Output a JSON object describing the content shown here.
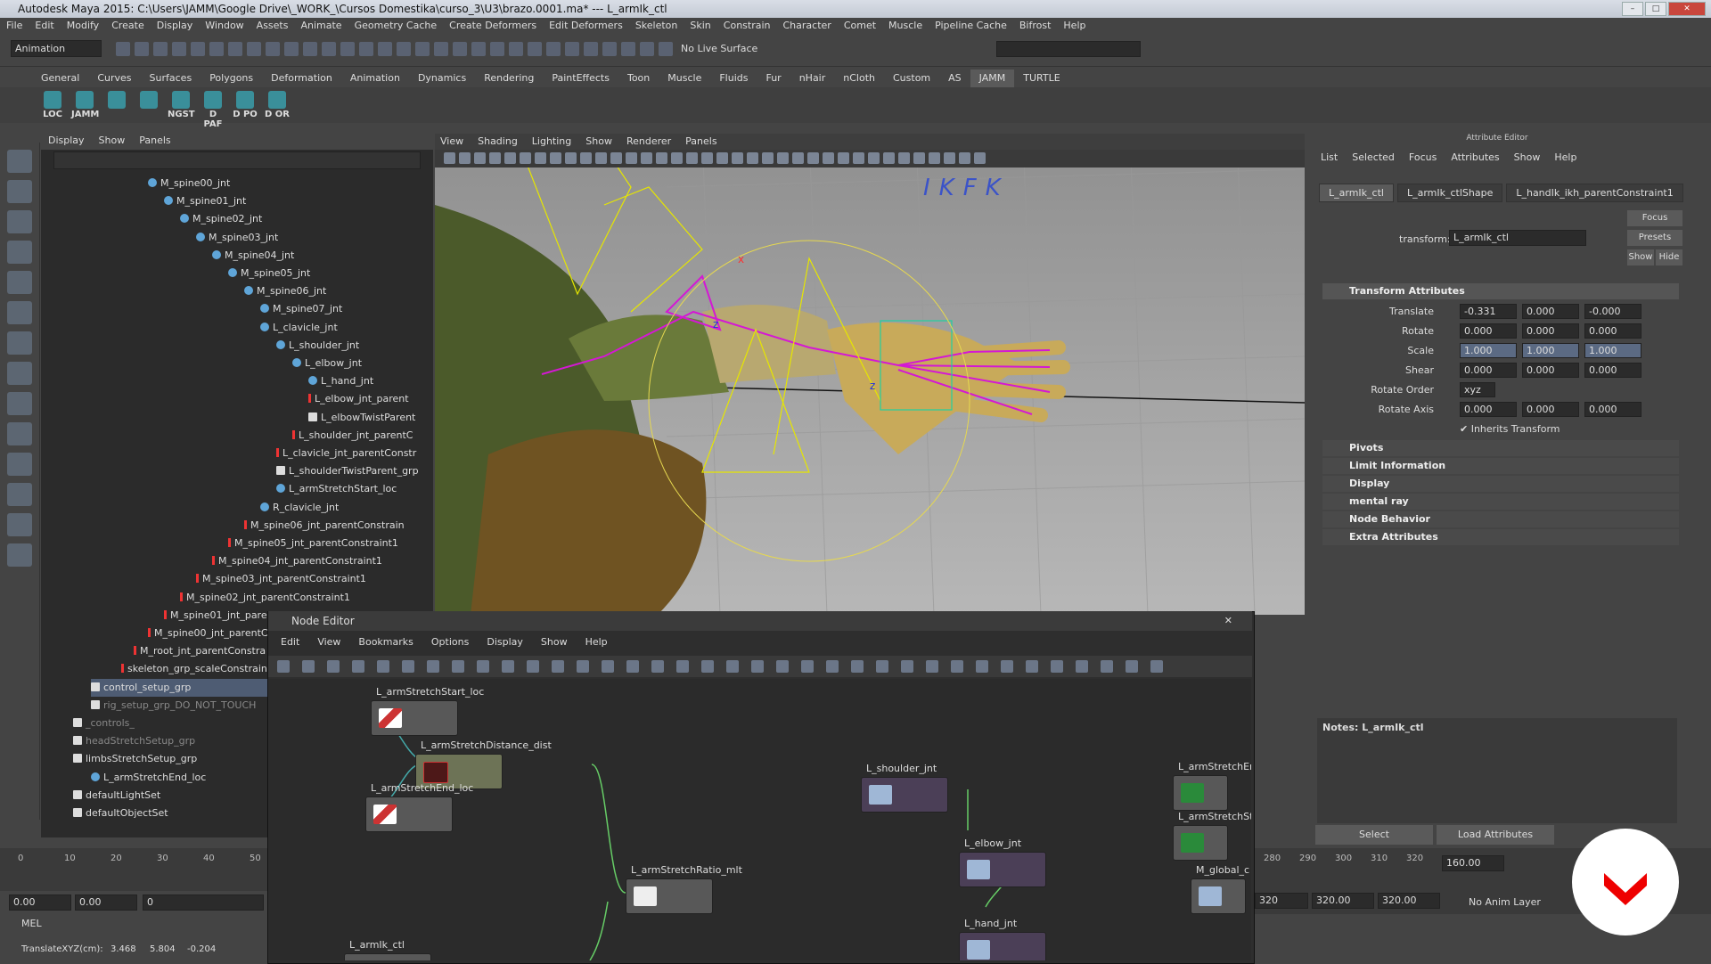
{
  "window": {
    "title": "Autodesk Maya 2015: C:\\Users\\JAMM\\Google Drive\\_WORK_\\Cursos Domestika\\curso_3\\U3\\brazo.0001.ma*   ---   L_armIk_ctl"
  },
  "menubar": [
    "File",
    "Edit",
    "Modify",
    "Create",
    "Display",
    "Window",
    "Assets",
    "Animate",
    "Geometry Cache",
    "Create Deformers",
    "Edit Deformers",
    "Skeleton",
    "Skin",
    "Constrain",
    "Character",
    "Comet",
    "Muscle",
    "Pipeline Cache",
    "Bifrost",
    "Help"
  ],
  "toolbar": {
    "mode": "Animation",
    "live_surface": "No Live Surface"
  },
  "shelf_tabs": [
    {
      "label": "General",
      "active": false
    },
    {
      "label": "Curves",
      "active": false
    },
    {
      "label": "Surfaces",
      "active": false
    },
    {
      "label": "Polygons",
      "active": false
    },
    {
      "label": "Deformation",
      "active": false
    },
    {
      "label": "Animation",
      "active": false
    },
    {
      "label": "Dynamics",
      "active": false
    },
    {
      "label": "Rendering",
      "active": false
    },
    {
      "label": "PaintEffects",
      "active": false
    },
    {
      "label": "Toon",
      "active": false
    },
    {
      "label": "Muscle",
      "active": false
    },
    {
      "label": "Fluids",
      "active": false
    },
    {
      "label": "Fur",
      "active": false
    },
    {
      "label": "nHair",
      "active": false
    },
    {
      "label": "nCloth",
      "active": false
    },
    {
      "label": "Custom",
      "active": false
    },
    {
      "label": "AS",
      "active": false
    },
    {
      "label": "JAMM",
      "active": true
    },
    {
      "label": "TURTLE",
      "active": false
    }
  ],
  "shelf_buttons": [
    "LOC",
    "JAMM",
    "",
    "",
    "NGST",
    "D PAF",
    "D PO",
    "D OR"
  ],
  "outliner": {
    "menu": [
      "Display",
      "Show",
      "Panels"
    ],
    "rows": [
      {
        "label": "M_spine00_jnt",
        "type": "joint",
        "state": "normal"
      },
      {
        "label": "M_spine01_jnt",
        "type": "joint",
        "state": "normal"
      },
      {
        "label": "M_spine02_jnt",
        "type": "joint",
        "state": "normal"
      },
      {
        "label": "M_spine03_jnt",
        "type": "joint",
        "state": "normal"
      },
      {
        "label": "M_spine04_jnt",
        "type": "joint",
        "state": "normal"
      },
      {
        "label": "M_spine05_jnt",
        "type": "joint",
        "state": "normal"
      },
      {
        "label": "M_spine06_jnt",
        "type": "joint",
        "state": "normal"
      },
      {
        "label": "M_spine07_jnt",
        "type": "joint",
        "state": "normal"
      },
      {
        "label": "L_clavicle_jnt",
        "type": "joint",
        "state": "normal"
      },
      {
        "label": "L_shoulder_jnt",
        "type": "joint",
        "state": "normal"
      },
      {
        "label": "L_elbow_jnt",
        "type": "joint",
        "state": "normal"
      },
      {
        "label": "L_hand_jnt",
        "type": "joint",
        "state": "normal"
      },
      {
        "label": "L_elbow_jnt_parent",
        "type": "constraint",
        "state": "normal"
      },
      {
        "label": "L_elbowTwistParent",
        "type": "group",
        "state": "normal"
      },
      {
        "label": "L_shoulder_jnt_parentC",
        "type": "constraint",
        "state": "normal"
      },
      {
        "label": "L_clavicle_jnt_parentConstr",
        "type": "constraint",
        "state": "normal"
      },
      {
        "label": "L_shoulderTwistParent_grp",
        "type": "group",
        "state": "normal"
      },
      {
        "label": "L_armStretchStart_loc",
        "type": "locator",
        "state": "normal"
      },
      {
        "label": "R_clavicle_jnt",
        "type": "joint",
        "state": "normal"
      },
      {
        "label": "M_spine06_jnt_parentConstrain",
        "type": "constraint",
        "state": "normal"
      },
      {
        "label": "M_spine05_jnt_parentConstraint1",
        "type": "constraint",
        "state": "normal"
      },
      {
        "label": "M_spine04_jnt_parentConstraint1",
        "type": "constraint",
        "state": "normal"
      },
      {
        "label": "M_spine03_jnt_parentConstraint1",
        "type": "constraint",
        "state": "normal"
      },
      {
        "label": "M_spine02_jnt_parentConstraint1",
        "type": "constraint",
        "state": "normal"
      },
      {
        "label": "M_spine01_jnt_parentConstraint1",
        "type": "constraint",
        "state": "normal"
      },
      {
        "label": "M_spine00_jnt_parentConstraint1",
        "type": "constraint",
        "state": "normal"
      },
      {
        "label": "M_root_jnt_parentConstra",
        "type": "constraint",
        "state": "normal"
      },
      {
        "label": "skeleton_grp_scaleConstraint1",
        "type": "constraint",
        "state": "normal"
      },
      {
        "label": "control_setup_grp",
        "type": "group",
        "state": "selected"
      },
      {
        "label": "rig_setup_grp_DO_NOT_TOUCH",
        "type": "group",
        "state": "dim"
      },
      {
        "label": "_controls_",
        "type": "group",
        "state": "dim"
      },
      {
        "label": "headStretchSetup_grp",
        "type": "group",
        "state": "dim"
      },
      {
        "label": "limbsStretchSetup_grp",
        "type": "group",
        "state": "normal"
      },
      {
        "label": "L_armStretchEnd_loc",
        "type": "locator",
        "state": "normal"
      },
      {
        "label": "defaultLightSet",
        "type": "set",
        "state": "normal"
      },
      {
        "label": "defaultObjectSet",
        "type": "set",
        "state": "normal"
      }
    ]
  },
  "viewport": {
    "menu": [
      "View",
      "Shading",
      "Lighting",
      "Show",
      "Renderer",
      "Panels"
    ],
    "overlay_text": "IKFK",
    "axis_labels": [
      "x",
      "z",
      "z"
    ]
  },
  "attribute_editor": {
    "title": "Attribute Editor",
    "menu": [
      "List",
      "Selected",
      "Focus",
      "Attributes",
      "Show",
      "Help"
    ],
    "tabs": [
      {
        "label": "L_armIk_ctl",
        "active": true
      },
      {
        "label": "L_armIk_ctlShape",
        "active": false
      },
      {
        "label": "L_handIk_ikh_parentConstraint1",
        "active": false
      }
    ],
    "transform_label": "transform:",
    "transform_value": "L_armIk_ctl",
    "buttons": {
      "focus": "Focus",
      "presets": "Presets",
      "show": "Show",
      "hide": "Hide"
    },
    "transform_section": "Transform Attributes",
    "attributes": [
      {
        "label": "Translate",
        "values": [
          "-0.331",
          "0.000",
          "-0.000"
        ],
        "highlight": false
      },
      {
        "label": "Rotate",
        "values": [
          "0.000",
          "0.000",
          "0.000"
        ],
        "highlight": false
      },
      {
        "label": "Scale",
        "values": [
          "1.000",
          "1.000",
          "1.000"
        ],
        "highlight": true
      },
      {
        "label": "Shear",
        "values": [
          "0.000",
          "0.000",
          "0.000"
        ],
        "highlight": false
      }
    ],
    "rotate_order_label": "Rotate Order",
    "rotate_order_value": "xyz",
    "rotate_axis_label": "Rotate Axis",
    "rotate_axis_values": [
      "0.000",
      "0.000",
      "0.000"
    ],
    "inherits_transform": "Inherits Transform",
    "collapsed_sections": [
      "Pivots",
      "Limit Information",
      "Display",
      "mental ray",
      "Node Behavior",
      "Extra Attributes"
    ],
    "notes_label": "Notes: L_armIk_ctl",
    "bottom_buttons": [
      "Select",
      "Load Attributes"
    ]
  },
  "node_editor": {
    "title": "Node Editor",
    "menu": [
      "Edit",
      "View",
      "Bookmarks",
      "Options",
      "Display",
      "Show",
      "Help"
    ],
    "nodes": [
      {
        "label": "L_armStretchStart_loc",
        "style": "locator"
      },
      {
        "label": "L_armStretchDistance_dist",
        "style": "distance"
      },
      {
        "label": "L_armStretchEnd_loc",
        "style": "locator"
      },
      {
        "label": "L_armStretchRatio_mlt",
        "style": "multiply"
      },
      {
        "label": "L_shoulder_jnt",
        "style": "joint"
      },
      {
        "label": "L_elbow_jnt",
        "style": "joint"
      },
      {
        "label": "L_hand_jnt",
        "style": "joint"
      },
      {
        "label": "L_armIk_ctl",
        "style": "locator"
      },
      {
        "label": "L_armStretchEr",
        "style": "multiply2"
      },
      {
        "label": "L_armStretchSt",
        "style": "multiply2"
      },
      {
        "label": "M_global_c",
        "style": "curve"
      }
    ]
  },
  "timeline": {
    "ticks": [
      "0",
      "10",
      "20",
      "30",
      "40",
      "50"
    ],
    "right_ticks": [
      "280",
      "290",
      "300",
      "310",
      "320"
    ],
    "current_frame": "160.00"
  },
  "range": {
    "start": "0.00",
    "inner_start": "0.00",
    "slider_value": "0",
    "end_value": "320",
    "end_a": "320.00",
    "end_b": "320.00",
    "anim_layer": "No Anim Layer"
  },
  "mel_label": "MEL",
  "help_line": {
    "label": "TranslateXYZ(cm):",
    "values": [
      "3.468",
      "5.804",
      "-0.204"
    ]
  }
}
